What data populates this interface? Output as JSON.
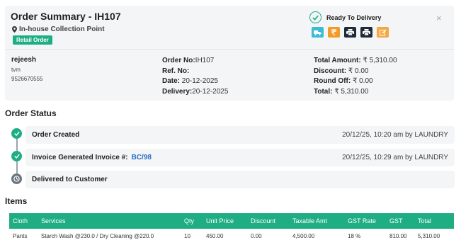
{
  "summary": {
    "title": "Order Summary - IH107",
    "location": "In-house Collection Point",
    "order_tag": "Retail Order",
    "status": "Ready To Delivery",
    "close_glyph": "×",
    "actions": [
      {
        "icon": "truck-icon",
        "color": "#3cbcd4"
      },
      {
        "icon": "rupee-icon",
        "color": "#f39b2a"
      },
      {
        "icon": "print-icon",
        "color": "#1f2b36"
      },
      {
        "icon": "print-icon",
        "color": "#1f2b36"
      },
      {
        "icon": "edit-icon",
        "color": "#f5a742"
      }
    ],
    "customer": {
      "name": "rejeesh",
      "city": "tvm",
      "phone": "9526670555"
    },
    "order": {
      "order_no_label": "Order No:",
      "order_no": "IH107",
      "ref_label": "Ref. No:",
      "ref": "",
      "date_label": "Date:",
      "date": "20-12-2025",
      "delivery_label": "Delivery:",
      "delivery": "20-12-2025"
    },
    "amounts": {
      "total_amount_label": "Total Amount:",
      "total_amount": "₹ 5,310.00",
      "discount_label": "Discount:",
      "discount": "₹ 0.00",
      "round_off_label": "Round Off:",
      "round_off": "₹ 0.00",
      "total_label": "Total:",
      "total": "₹ 5,310.00"
    }
  },
  "order_status": {
    "heading": "Order Status",
    "steps": [
      {
        "label": "Order Created",
        "ref": "",
        "stamp": "20/12/25, 10:20 am by LAUNDRY",
        "state": "done"
      },
      {
        "label": "Invoice Generated Invoice #:",
        "ref": "BC/98",
        "stamp": "20/12/25, 10:29 am by LAUNDRY",
        "state": "done"
      },
      {
        "label": "Delivered to Customer",
        "ref": "",
        "stamp": "",
        "state": "pending"
      }
    ]
  },
  "items": {
    "heading": "Items",
    "columns": [
      "Cloth",
      "Services",
      "Qty",
      "Unit Price",
      "Discount",
      "Taxable Amt",
      "GST Rate",
      "GST",
      "Total"
    ],
    "rows": [
      [
        "Pants",
        "Starch Wash @230.0 / Dry Cleaning @220.0",
        "10",
        "450.00",
        "0.00",
        "4,500.00",
        "18 %",
        "810.00",
        "5,310.00"
      ]
    ]
  },
  "colors": {
    "accent": "#1fae84",
    "link": "#2a6cbf",
    "panel": "#f4f5f7"
  }
}
